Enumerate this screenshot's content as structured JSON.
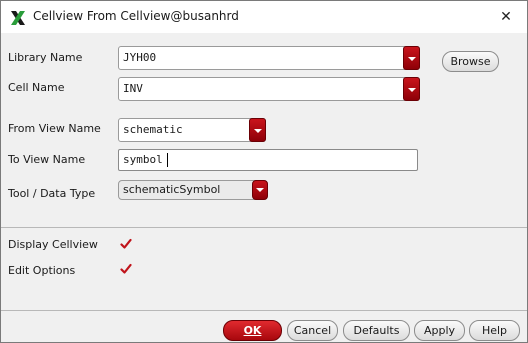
{
  "window": {
    "title": "Cellview From Cellview@busanhrd",
    "close_glyph": "✕"
  },
  "form": {
    "library": {
      "label": "Library Name",
      "value": "JYH00"
    },
    "cell": {
      "label": "Cell Name",
      "value": "INV"
    },
    "from_view": {
      "label": "From View Name",
      "value": "schematic"
    },
    "to_view": {
      "label": "To View Name",
      "value": "symbol"
    },
    "tool_type": {
      "label": "Tool / Data Type",
      "value": "schematicSymbol"
    },
    "browse_label": "Browse"
  },
  "options": {
    "display_cellview": {
      "label": "Display Cellview",
      "checked": true
    },
    "edit_options": {
      "label": "Edit Options",
      "checked": true
    }
  },
  "buttons": {
    "ok": "OK",
    "cancel": "Cancel",
    "defaults": "Defaults",
    "apply": "Apply",
    "help": "Help"
  },
  "colors": {
    "accent": "#b30d12",
    "check": "#c0141b"
  },
  "icons": {
    "app": "cadence-x-icon",
    "close": "close-icon",
    "checkmark": "checkmark-icon",
    "dropdown": "dropdown-arrow-icon"
  }
}
